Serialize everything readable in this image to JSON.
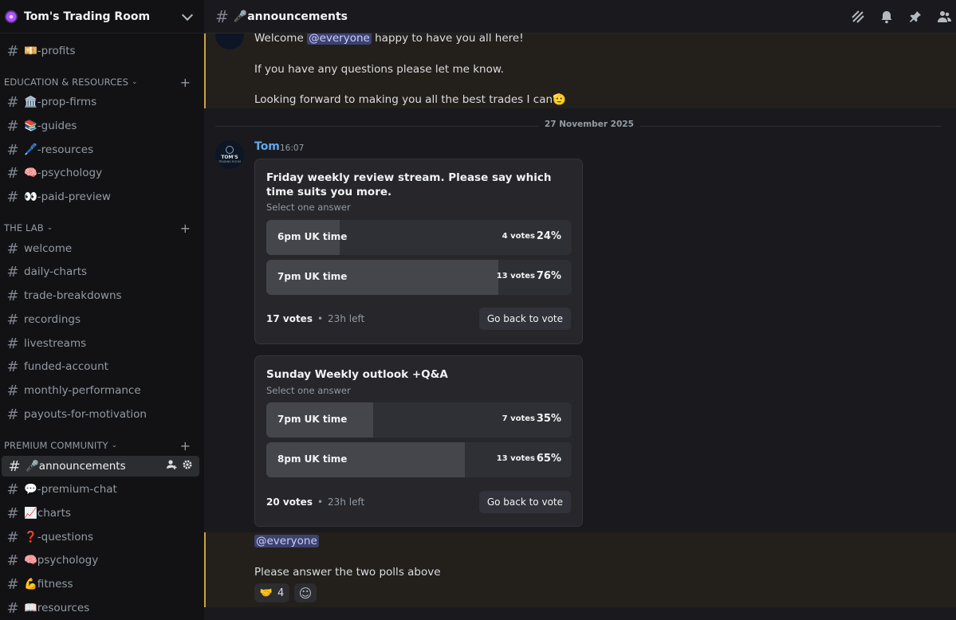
{
  "server": {
    "name": "Tom's Trading Room"
  },
  "sidebar": {
    "channels_top": [
      {
        "label": "💴-profits"
      }
    ],
    "categories": [
      {
        "label": "EDUCATION & RESOURCES"
      },
      {
        "label": "THE LAB"
      },
      {
        "label": "PREMIUM COMMUNITY"
      }
    ],
    "education": [
      {
        "label": "🏛️-prop-firms"
      },
      {
        "label": "📚-guides"
      },
      {
        "label": "🖊️-resources"
      },
      {
        "label": "🧠-psychology"
      },
      {
        "label": "👀-paid-preview"
      }
    ],
    "lab": [
      {
        "label": "welcome"
      },
      {
        "label": "daily-charts"
      },
      {
        "label": "trade-breakdowns"
      },
      {
        "label": "recordings"
      },
      {
        "label": "livestreams"
      },
      {
        "label": "funded-account"
      },
      {
        "label": "monthly-performance"
      },
      {
        "label": "payouts-for-motivation"
      }
    ],
    "premium": [
      {
        "label": "🎤announcements"
      },
      {
        "label": "💬-premium-chat"
      },
      {
        "label": "📈charts"
      },
      {
        "label": "❓-questions"
      },
      {
        "label": "🧠psychology"
      },
      {
        "label": "💪fitness"
      },
      {
        "label": "📖resources"
      }
    ]
  },
  "topbar": {
    "channel_title": "🎤announcements"
  },
  "messages": {
    "welcome_prefix": "Welcome",
    "mention": "@everyone",
    "welcome_suffix": "happy to have you all here!",
    "questions_line": "If you have any questions please let me know.",
    "forward_line": "Looking forward to making you all the best trades I can",
    "forward_emoji": "🫡",
    "date_divider": "27 November 2025",
    "author": "Tom",
    "time": "16:07",
    "avatar_text_top": "TOM'S",
    "avatar_text_bottom": "TRADING ROOM",
    "mention2": "@everyone",
    "final_line": "Please answer the two polls above",
    "reaction_emoji": "🤝",
    "reaction_count": "4",
    "add_reaction_icon": "☺"
  },
  "polls": [
    {
      "question": "Friday weekly review stream. Please say which time suits you more.",
      "select_hint": "Select one answer",
      "answers": [
        {
          "label": "6pm UK time",
          "votes": "4 votes",
          "percent": "24%",
          "fraction": 0.24
        },
        {
          "label": "7pm UK time",
          "votes": "13 votes",
          "percent": "76%",
          "fraction": 0.76
        }
      ],
      "total_votes": "17 votes",
      "time_left": "23h left",
      "button": "Go back to vote"
    },
    {
      "question": "Sunday Weekly outlook +Q&A",
      "select_hint": "Select one answer",
      "answers": [
        {
          "label": "7pm UK time",
          "votes": "7 votes",
          "percent": "35%",
          "fraction": 0.35
        },
        {
          "label": "8pm UK time",
          "votes": "13 votes",
          "percent": "65%",
          "fraction": 0.65
        }
      ],
      "total_votes": "20 votes",
      "time_left": "23h left",
      "button": "Go back to vote"
    }
  ],
  "icons": {
    "threads": "threads-icon",
    "bell": "bell-icon",
    "pin": "pin-icon",
    "members": "members-icon",
    "add_member": "add-member-icon",
    "settings": "gear-icon"
  },
  "colors": {
    "accent_mention": "#3c4270",
    "author_name": "#5fa8e8",
    "highlight_border": "#c9a24a"
  }
}
